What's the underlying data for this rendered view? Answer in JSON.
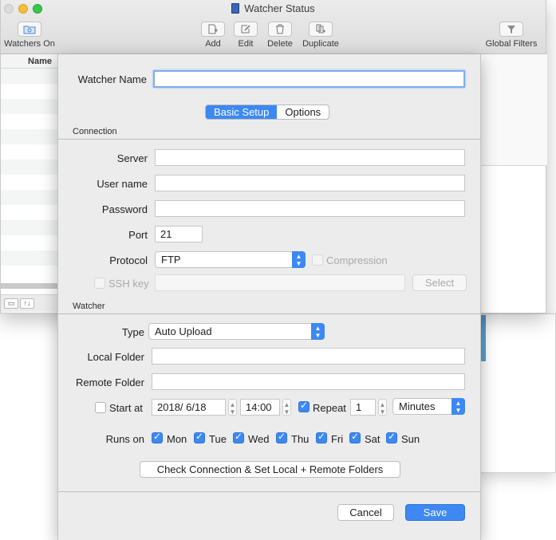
{
  "window": {
    "title": "Watcher Status",
    "toolbar": {
      "watchers_on": "Watchers On",
      "add": "Add",
      "edit": "Edit",
      "delete": "Delete",
      "duplicate": "Duplicate",
      "global_filters": "Global Filters"
    },
    "list_header": "Name"
  },
  "sheet": {
    "watcher_name_label": "Watcher Name",
    "watcher_name_value": "",
    "tabs": [
      "Basic Setup",
      "Options"
    ],
    "connection": {
      "section": "Connection",
      "server_label": "Server",
      "server_value": "",
      "username_label": "User name",
      "username_value": "",
      "password_label": "Password",
      "password_value": "",
      "port_label": "Port",
      "port_value": "21",
      "protocol_label": "Protocol",
      "protocol_value": "FTP",
      "compression_label": "Compression",
      "sshkey_label": "SSH key",
      "sshkey_value": "",
      "select_label": "Select"
    },
    "watcher": {
      "section": "Watcher",
      "type_label": "Type",
      "type_value": "Auto Upload",
      "local_folder_label": "Local Folder",
      "local_folder_value": "",
      "remote_folder_label": "Remote Folder",
      "remote_folder_value": "",
      "start_at_label": "Start at",
      "start_date": "2018/  6/18",
      "start_time": "14:00",
      "repeat_label": "Repeat",
      "repeat_value": "1",
      "repeat_unit": "Minutes",
      "runs_on_label": "Runs on",
      "days": [
        "Mon",
        "Tue",
        "Wed",
        "Thu",
        "Fri",
        "Sat",
        "Sun"
      ],
      "check_button": "Check Connection & Set Local + Remote Folders"
    },
    "cancel": "Cancel",
    "save": "Save"
  }
}
